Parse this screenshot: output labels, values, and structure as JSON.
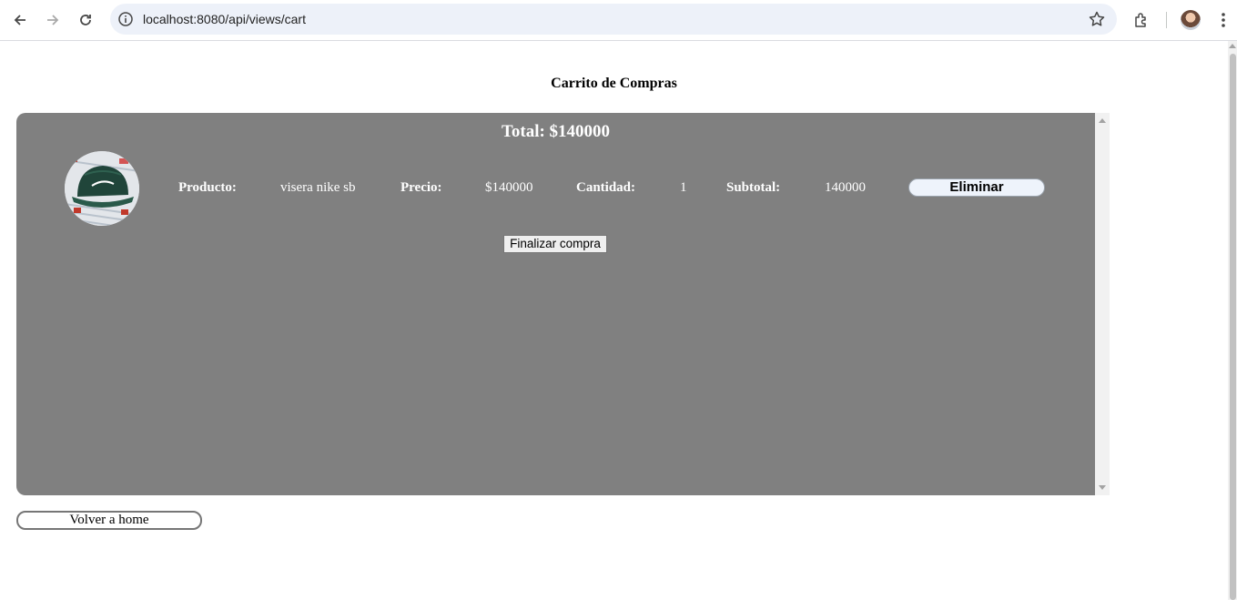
{
  "browser": {
    "url": "localhost:8080/api/views/cart",
    "icons": [
      "back-arrow-icon",
      "forward-arrow-icon",
      "reload-icon",
      "site-info-icon",
      "bookmark-star-icon",
      "extensions-icon",
      "profile-avatar",
      "more-menu-icon"
    ]
  },
  "page": {
    "title": "Carrito de Compras"
  },
  "cart": {
    "total": "Total: $140000",
    "items": [
      {
        "image_alt": "green cap",
        "producto_label": "Producto:",
        "producto": "visera nike sb",
        "precio_label": "Precio:",
        "precio": "$140000",
        "cantidad_label": "Cantidad:",
        "cantidad": "1",
        "subtotal_label": "Subtotal:",
        "subtotal": "140000",
        "eliminar_label": "Eliminar"
      }
    ],
    "finalizar_label": "Finalizar compra"
  },
  "footer": {
    "home_label": "Volver a home"
  },
  "colors": {
    "panel_bg": "#808080",
    "text_on_panel": "#ffffff",
    "eliminar_bg": "#eef3fb"
  }
}
